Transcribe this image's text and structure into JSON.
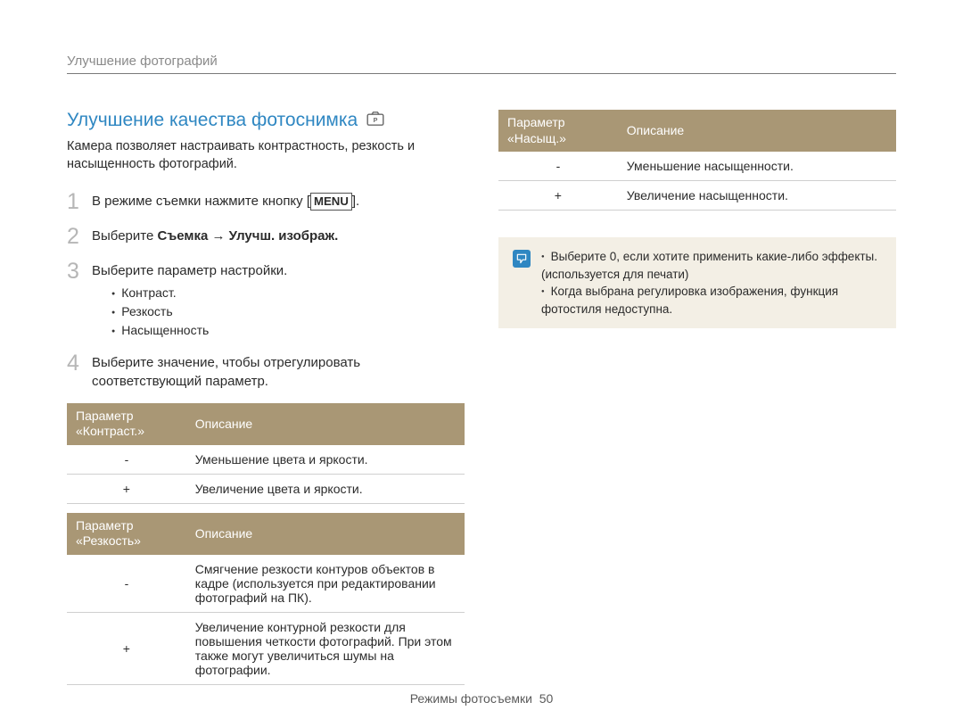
{
  "header": "Улучшение фотографий",
  "title": "Улучшение качества фотоснимка",
  "intro": "Камера позволяет настраивать контрастность, резкость и насыщенность фотографий.",
  "steps": {
    "s1_prefix": "В режиме съемки нажмите кнопку [",
    "s1_button": "MENU",
    "s1_suffix": "].",
    "s2_prefix": "Выберите ",
    "s2_bold": "Съемка → Улучш. изображ.",
    "s3": "Выберите параметр настройки.",
    "s3_items": [
      "Контраст.",
      "Резкость",
      "Насыщенность"
    ],
    "s4": "Выберите значение, чтобы отрегулировать соответствующий параметр."
  },
  "tables": {
    "contrast": {
      "h1": "Параметр «Контраст.»",
      "h2": "Описание",
      "rows": [
        {
          "sym": "-",
          "desc": "Уменьшение цвета и яркости."
        },
        {
          "sym": "+",
          "desc": "Увеличение цвета и яркости."
        }
      ]
    },
    "sharpness": {
      "h1": "Параметр «Резкость»",
      "h2": "Описание",
      "rows": [
        {
          "sym": "-",
          "desc": "Смягчение резкости контуров объектов в кадре (используется при редактировании фотографий на ПК)."
        },
        {
          "sym": "+",
          "desc": "Увеличение контурной резкости для повышения четкости фотографий. При этом также могут увеличиться шумы на фотографии."
        }
      ]
    },
    "saturation": {
      "h1": "Параметр «Насыщ.»",
      "h2": "Описание",
      "rows": [
        {
          "sym": "-",
          "desc": "Уменьшение насыщенности."
        },
        {
          "sym": "+",
          "desc": "Увеличение насыщенности."
        }
      ]
    }
  },
  "notes": [
    "Выберите 0, если хотите применить какие-либо эффекты. (используется для печати)",
    "Когда выбрана регулировка изображения, функция фотостиля недоступна."
  ],
  "footer_label": "Режимы фотосъемки",
  "footer_page": "50"
}
